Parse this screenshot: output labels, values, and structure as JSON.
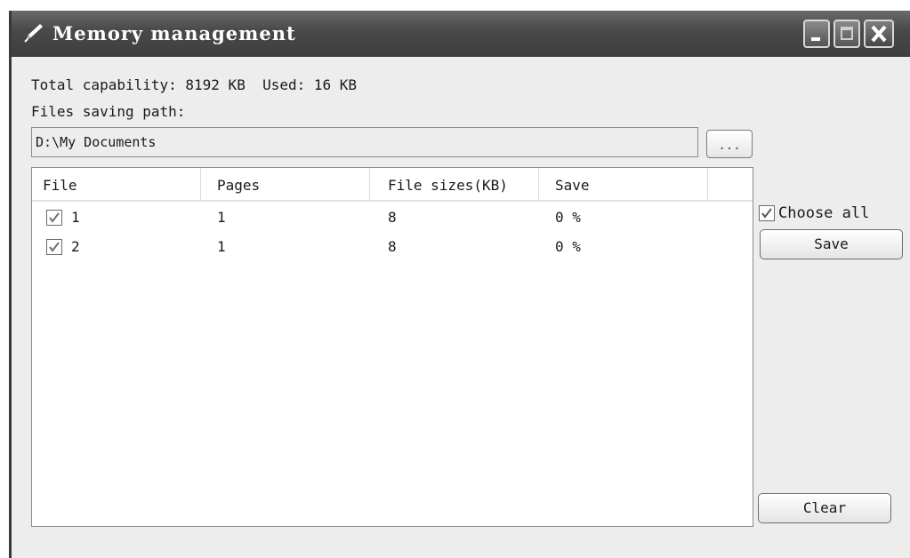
{
  "window": {
    "title": "Memory management"
  },
  "info": {
    "total_capability_text": "Total capability: 8192 KB  Used: 16 KB",
    "path_label": "Files saving path:"
  },
  "path_field": {
    "value": "D:\\My Documents"
  },
  "browse_button": {
    "label": "..."
  },
  "table": {
    "columns": [
      "File",
      "Pages",
      "File sizes(KB)",
      "Save"
    ],
    "rows": [
      {
        "checked": true,
        "file": "1",
        "pages": "1",
        "size": "8",
        "save": "0 %"
      },
      {
        "checked": true,
        "file": "2",
        "pages": "1",
        "size": "8",
        "save": "0 %"
      }
    ]
  },
  "side_panel": {
    "choose_all_label": "Choose all",
    "choose_all_checked": true,
    "save_label": "Save",
    "clear_label": "Clear"
  },
  "icons": {
    "title": "pencil-icon",
    "minimize": "minimize-icon",
    "maximize": "maximize-icon",
    "close": "close-icon",
    "check": "checkmark-icon"
  },
  "colors": {
    "titlebar": "#4a4a4a",
    "window_bg": "#ededed",
    "list_bg": "#ffffff"
  }
}
